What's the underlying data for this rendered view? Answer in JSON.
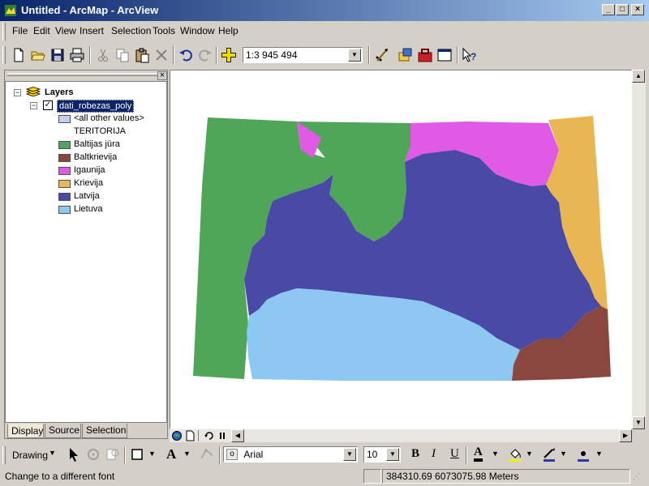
{
  "window": {
    "title": "Untitled - ArcMap - ArcView"
  },
  "menu": [
    "File",
    "Edit",
    "View",
    "Insert",
    "Selection",
    "Tools",
    "Window",
    "Help"
  ],
  "toolbar": {
    "scale": "1:3 945 494"
  },
  "toc": {
    "root_label": "Layers",
    "layer_name": "dati_robezas_poly",
    "other_values": "<all other values>",
    "field_name": "TERITORIJA",
    "classes": [
      {
        "label": "Baltijas jūra",
        "color": "#4fa558"
      },
      {
        "label": "Baltkrievija",
        "color": "#8a473f"
      },
      {
        "label": "Igaunija",
        "color": "#e15ae6"
      },
      {
        "label": "Krievija",
        "color": "#e8b653"
      },
      {
        "label": "Latvija",
        "color": "#4949a6"
      },
      {
        "label": "Lietuva",
        "color": "#8cc8f2"
      }
    ],
    "tabs": [
      "Display",
      "Source",
      "Selection"
    ]
  },
  "drawing_toolbar": {
    "drawing_label": "Drawing",
    "font": "Arial",
    "font_size": "10",
    "bold": "B",
    "italic": "I",
    "underline": "U",
    "font_color_glyph": "A"
  },
  "status": {
    "message": "Change to a different font",
    "coords": "384310.69  6073075.98 Meters"
  }
}
